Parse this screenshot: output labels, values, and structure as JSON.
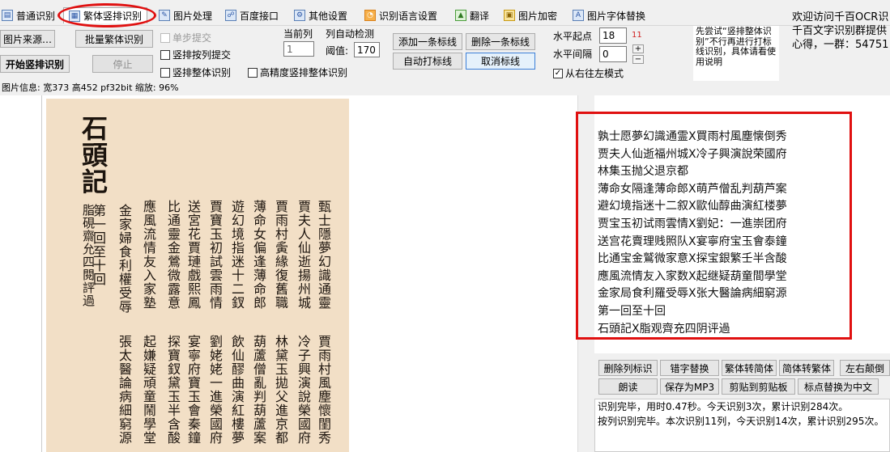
{
  "tabs": [
    {
      "label": "普通识别",
      "icon": "doc-icon"
    },
    {
      "label": "繁体竖排识别",
      "icon": "image-icon",
      "active": true
    },
    {
      "label": "图片处理",
      "icon": "image-edit-icon"
    },
    {
      "label": "百度接口",
      "icon": "network-icon"
    },
    {
      "label": "其他设置",
      "icon": "settings-icon"
    },
    {
      "label": "识别语言设置",
      "icon": "rss-icon"
    },
    {
      "label": "翻译",
      "icon": "translate-icon"
    },
    {
      "label": "图片加密",
      "icon": "lock-icon"
    },
    {
      "label": "图片字体替换",
      "icon": "font-icon"
    }
  ],
  "toolbar": {
    "image_source": "图片来源…",
    "batch_recognize": "批量繁体识别",
    "start": "开始竖排识别",
    "stop": "停止",
    "step_submit": "单步提交",
    "submit_by_column": "竖排按列提交",
    "whole_recognize": "竖排整体识别",
    "hq_whole": "高精度竖排整体识别",
    "current_col_label": "当前列",
    "current_col_value": "1",
    "auto_detect_label": "列自动检测",
    "threshold_label": "阈值:",
    "threshold_value": "170",
    "add_line": "添加一条标线",
    "delete_line": "删除一条标线",
    "auto_line": "自动打标线",
    "cancel_line": "取消标线",
    "h_start_label": "水平起点",
    "h_start_value": "18",
    "h_start_hint": "11",
    "h_gap_label": "水平间隔",
    "h_gap_value": "0",
    "rtl_label": "从右往左模式",
    "tip": "先尝试“竖排整体识别”不行再进行打标线识别，具体请看使用说明"
  },
  "welcome": [
    "欢迎访问千百OCR识",
    "千百文字识别群提供",
    "心得，一群：54751"
  ],
  "status": "图片信息: 宽373 高452 pf32bit 缩放: 96%",
  "scan_columns": [
    "石頭記",
    "脂硯齋允四閱評過",
    "第一回至十回",
    "金家婦食利權受辱",
    "應風流情友入家塾",
    "比通靈金鶯微露意",
    "送宮花賈璉戲熙鳳",
    "賈寶玉初試雲雨情",
    "遊幻境指迷十二釵",
    "薄命女偏逢薄命郎",
    "賈雨村夤緣復舊職",
    "賈夫人仙逝揚州城",
    "甄士隱夢幻識通靈",
    "張太醫論病細窮源",
    "起嫌疑頑童鬧學堂",
    "探寶釵黛玉半含酸",
    "宴寧府寶玉會秦鐘",
    "劉姥姥一進榮國府",
    "飲仙醪曲演紅樓夢",
    "葫蘆僧亂判葫蘆案",
    "林黛玉拋父進京都",
    "冷子興演說榮國府",
    "賈雨村風塵懷閨秀"
  ],
  "result_lines": [
    "孰士愿夢幻識通霊X買雨村風塵懐倒秀",
    "贾夫人仙逝福州城X冷子興演說荣國府",
    "林集玉抛父退京都",
    "薄命女隔逢薄命郎X萌芦僧乱判葫芦案",
    "避幻境指迷十二叙X歐仙醇曲演紅楼夢",
    "贾宝玉初试雨雲情X劉妃：一進崇团府",
    "送宫花賣理贱照队X宴寧府宝玉會泰鐘",
    "比通宝金鷲微家意X探宝銀繁壬半含酸",
    "應風流情友入家数X起继疑葫童間學堂",
    "金家局食利羅受辱X张大醫論病細窮源",
    "第一回至十回",
    "石頭記X脂观齊充四阴评過"
  ],
  "action_buttons_row1": [
    "删除列标识",
    "错字替换",
    "繁体转简体",
    "简体转繁体",
    "左右颠倒"
  ],
  "action_buttons_row2": [
    "朗读",
    "保存为MP3",
    "剪贴到剪贴板",
    "标点替换为中文"
  ],
  "log": [
    "识别完毕，用时0.47秒。今天识别3次，累计识别284次。",
    "按列识别完毕。本次识别11列，今天识别14次，累计识别295次。"
  ]
}
